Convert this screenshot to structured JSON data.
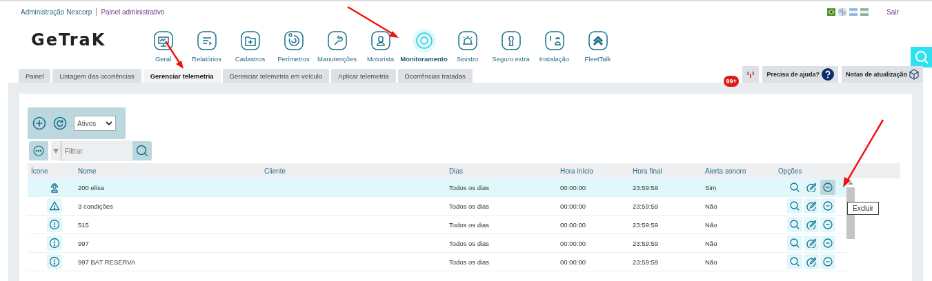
{
  "breadcrumb": {
    "company": "Administração Nexcorp",
    "page": "Painel administrativo"
  },
  "logout": "Sair",
  "logo": "GeTraK",
  "nav": [
    {
      "label": "Geral",
      "selected": false
    },
    {
      "label": "Relatórios",
      "selected": false
    },
    {
      "label": "Cadastros",
      "selected": false
    },
    {
      "label": "Perímetros",
      "selected": false
    },
    {
      "label": "Manutenções",
      "selected": false
    },
    {
      "label": "Motorista",
      "selected": false
    },
    {
      "label": "Monitoramento",
      "selected": true
    },
    {
      "label": "Sinistro",
      "selected": false
    },
    {
      "label": "Seguro extra",
      "selected": false
    },
    {
      "label": "Instalação",
      "selected": false
    },
    {
      "label": "FleetTalk",
      "selected": false
    }
  ],
  "tabs": [
    {
      "label": "Painel",
      "selected": false
    },
    {
      "label": "Listagem das ocorrências",
      "selected": false
    },
    {
      "label": "Gerenciar telemetria",
      "selected": true
    },
    {
      "label": "Gerenciar telemetria em veículo",
      "selected": false
    },
    {
      "label": "Aplicar telemetria",
      "selected": false
    },
    {
      "label": "Ocorrências tratadas",
      "selected": false
    }
  ],
  "notifications": {
    "badge": "99+"
  },
  "help_button": "Precisa de ajuda?",
  "notes_button": "Notas de atualização",
  "status_filter": {
    "value": "Ativos"
  },
  "filter": {
    "placeholder": "Filtrar"
  },
  "table": {
    "columns": [
      "Ícone",
      "Nome",
      "Cliente",
      "Dias",
      "Hora início",
      "Hora final",
      "Alerta sonoro",
      "Opções"
    ],
    "rows": [
      {
        "kind": "headset",
        "selected": true,
        "name": "200 elisa",
        "days": "Todos os dias",
        "start": "00:00:00",
        "end": "23:59:59",
        "sound": "Sim"
      },
      {
        "kind": "warning",
        "selected": false,
        "name": "3 condições",
        "days": "Todos os dias",
        "start": "00:00:00",
        "end": "23:59:59",
        "sound": "Não"
      },
      {
        "kind": "alert",
        "selected": false,
        "name": "515",
        "days": "Todos os dias",
        "start": "00:00:00",
        "end": "23:59:59",
        "sound": "Não"
      },
      {
        "kind": "alert",
        "selected": false,
        "name": "997",
        "days": "Todos os dias",
        "start": "00:00:00",
        "end": "23:59:59",
        "sound": "Não"
      },
      {
        "kind": "alert",
        "selected": false,
        "name": "997 BAT RESERVA",
        "days": "Todos os dias",
        "start": "00:00:00",
        "end": "23:59:59",
        "sound": "Não"
      }
    ]
  },
  "tooltip": "Excluir"
}
